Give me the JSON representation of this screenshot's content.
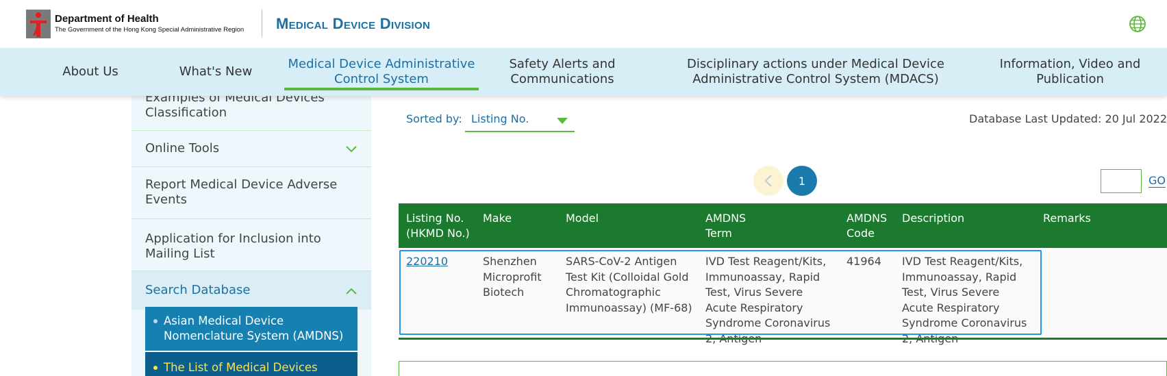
{
  "header": {
    "dept_name": "Department of Health",
    "dept_sub": "The Government of the Hong Kong Special Administrative Region",
    "division_title": "Medical Device Division",
    "globe_icon": "globe-icon"
  },
  "nav": {
    "items": [
      {
        "label": "About Us"
      },
      {
        "label": "What's New"
      },
      {
        "label": "Medical Device Administrative Control System",
        "active": true
      },
      {
        "label": "Safety Alerts and Communications"
      },
      {
        "label": "Disciplinary actions under Medical Device Administrative Control System (MDACS)"
      },
      {
        "label": "Information, Video and Publication"
      }
    ]
  },
  "sidebar": {
    "items": [
      {
        "label": "Examples of Medical Devices Classification",
        "icon": "chevron-down-icon"
      },
      {
        "label": "Online Tools",
        "icon": "chevron-down-icon"
      },
      {
        "label": "Report Medical Device Adverse Events"
      },
      {
        "label": "Application for Inclusion into Mailing List"
      },
      {
        "label": "Search Database",
        "icon": "chevron-up-icon",
        "expanded": true
      }
    ],
    "sub_items": [
      {
        "label": "Asian Medical Device Nomenclature System (AMDNS)"
      },
      {
        "label": "The List of Medical Devices",
        "current": true
      }
    ]
  },
  "toolbar": {
    "sorted_by_label": "Sorted by:",
    "sort_value": "Listing No.",
    "db_updated": "Database Last Updated: 20 Jul 2022"
  },
  "pagination": {
    "prev_icon": "chevron-left-icon",
    "current_page": "1",
    "goto_value": "",
    "go_label": "GO"
  },
  "table": {
    "headers": [
      "Listing No. (HKMD No.)",
      "Make",
      "Model",
      "AMDNS Term",
      "AMDNS Code",
      "Description",
      "Remarks"
    ],
    "rows": [
      {
        "listing_no": "220210",
        "make": "Shenzhen Microprofit Biotech",
        "model": "SARS-CoV-2 Antigen Test Kit (Colloidal Gold Chromatographic Immunoassay) (MF-68)",
        "amdns_term": "IVD Test Reagent/Kits, Immunoassay, Rapid Test, Virus Severe Acute Respiratory Syndrome Coronavirus 2, Antigen",
        "amdns_code": "41964",
        "description": "IVD Test Reagent/Kits, Immunoassay, Rapid Test, Virus Severe Acute Respiratory Syndrome Coronavirus 2, Antigen",
        "remarks": ""
      }
    ]
  },
  "colors": {
    "brand_blue": "#1a6fa3",
    "accent_green": "#5cb83a",
    "table_header_green": "#1b7a2e",
    "nav_bg": "#d8eef7"
  }
}
